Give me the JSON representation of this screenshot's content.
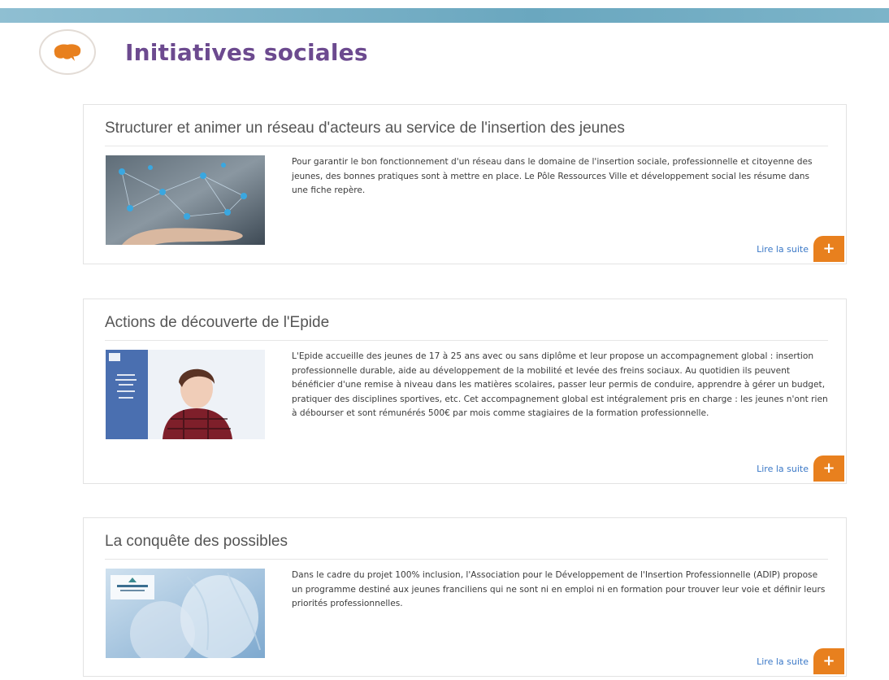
{
  "header": {
    "title": "Initiatives sociales",
    "icon": "speech-bubble-icon",
    "accent_color": "#e8801e",
    "title_color": "#6c4a8f"
  },
  "cards": [
    {
      "title": "Structurer et animer un réseau d'acteurs au service de l'insertion des jeunes",
      "text": "Pour garantir le bon fonctionnement d'un réseau dans le domaine de l'insertion sociale, professionnelle et citoyenne des jeunes, des bonnes pratiques sont à mettre en place. Le Pôle Ressources Ville et développement social les résume dans une fiche repère.",
      "read_more": "Lire la suite",
      "plus": "+",
      "image": "network-hand-image"
    },
    {
      "title": "Actions de découverte de l'Epide",
      "text": "L'Epide accueille des jeunes de 17 à 25 ans avec ou sans diplôme et leur propose un accompagnement global : insertion professionnelle durable, aide au développement de la mobilité et levée des freins sociaux. Au quotidien ils peuvent bénéficier d'une remise à niveau dans les matières scolaires, passer leur permis de conduire, apprendre à gérer un budget, pratiquer des disciplines sportives, etc. Cet accompagnement global est intégralement pris en charge : les jeunes n'ont rien à débourser et sont rémunérés 500€ par mois comme stagiaires de la formation professionnelle.",
      "read_more": "Lire la suite",
      "plus": "+",
      "image": "epide-brochure-image"
    },
    {
      "title": "La conquête des possibles",
      "text": "Dans le cadre du projet 100% inclusion, l'Association pour le Développement de l'Insertion Professionnelle (ADIP) propose un programme destiné aux jeunes franciliens qui ne sont ni en emploi ni en formation pour trouver leur voie et définir leurs priorités professionnelles.",
      "read_more": "Lire la suite",
      "plus": "+",
      "image": "conquete-poster-image"
    }
  ]
}
